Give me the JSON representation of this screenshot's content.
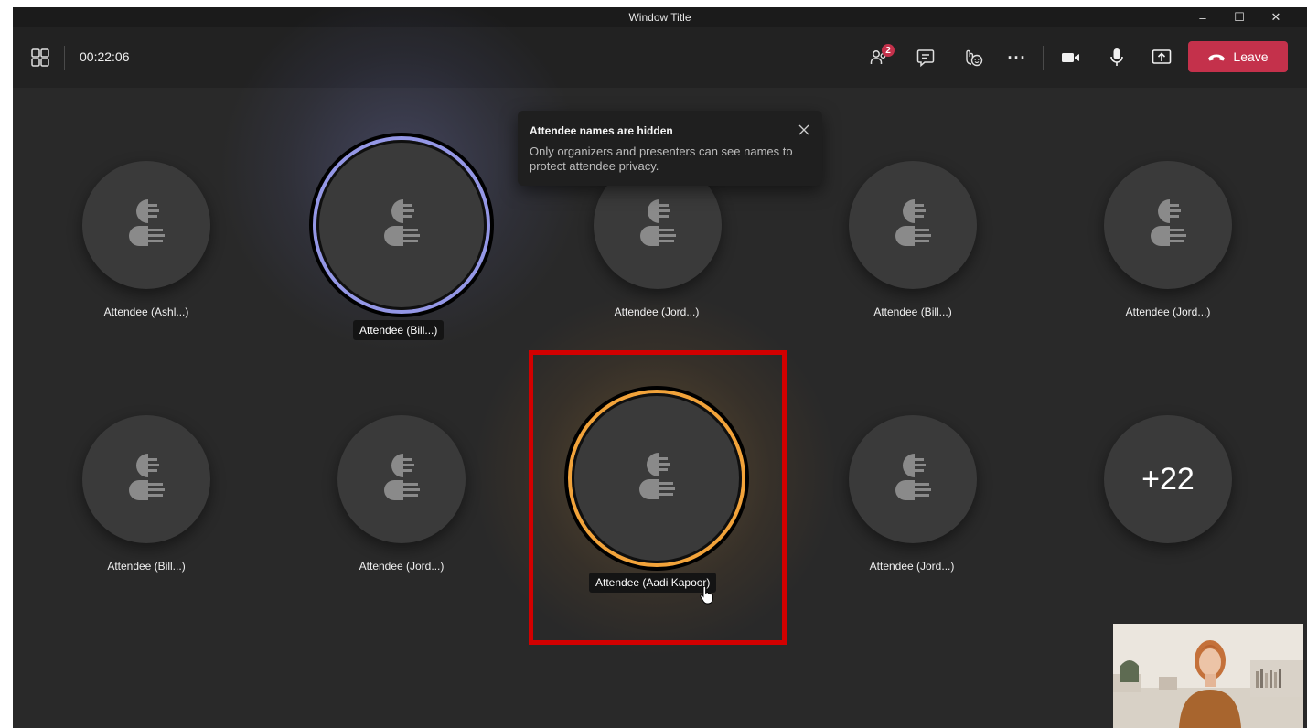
{
  "window": {
    "title": "Window Title",
    "minimize": "–",
    "maximize": "☐",
    "close": "✕"
  },
  "toolbar": {
    "timer": "00:22:06",
    "participants_badge": "2",
    "more_label": "···",
    "leave_label": "Leave",
    "icons": [
      "layout-grid-icon",
      "participants-icon",
      "chat-icon",
      "reactions-icon",
      "more-icon",
      "camera-icon",
      "microphone-icon",
      "share-screen-icon",
      "phone-hangup-icon"
    ]
  },
  "tooltip": {
    "title": "Attendee names are hidden",
    "body": "Only organizers and presenters can see names to protect attendee privacy."
  },
  "gallery": {
    "row1": [
      "Attendee (Ashl...)",
      "Attendee (Bill...)",
      "Attendee (Jord...)",
      "Attendee (Bill...)",
      "Attendee (Jord...)"
    ],
    "row2": [
      "Attendee (Bill...)",
      "Attendee (Jord...)",
      "Attendee (Aadi Kapoor)",
      "Attendee (Jord...)"
    ],
    "overflow_count": "+22"
  },
  "colors": {
    "background": "#292929",
    "toolbar": "#222222",
    "leave_button": "#c4314b",
    "speaking_ring_blue": "#9497e6",
    "speaking_ring_orange": "#f2a33a",
    "highlight": "#d20000"
  }
}
